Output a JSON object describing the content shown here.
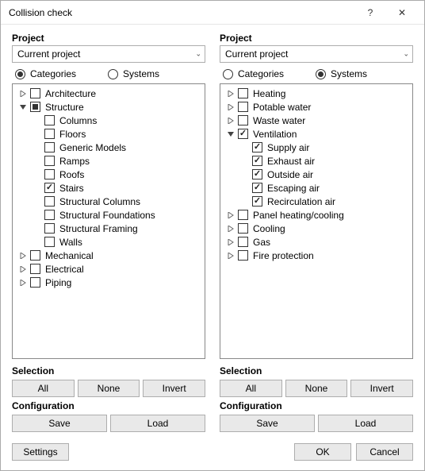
{
  "window": {
    "title": "Collision check",
    "help": "?",
    "close": "✕"
  },
  "left": {
    "project_label": "Project",
    "project_value": "Current project",
    "radio_categories": "Categories",
    "radio_systems": "Systems",
    "radio_selected": "categories",
    "tree": [
      {
        "depth": 0,
        "expander": "closed",
        "check": "unchecked",
        "label": "Architecture"
      },
      {
        "depth": 0,
        "expander": "open",
        "check": "ind",
        "label": "Structure"
      },
      {
        "depth": 1,
        "expander": "none",
        "check": "unchecked",
        "label": "Columns"
      },
      {
        "depth": 1,
        "expander": "none",
        "check": "unchecked",
        "label": "Floors"
      },
      {
        "depth": 1,
        "expander": "none",
        "check": "unchecked",
        "label": "Generic Models"
      },
      {
        "depth": 1,
        "expander": "none",
        "check": "unchecked",
        "label": "Ramps"
      },
      {
        "depth": 1,
        "expander": "none",
        "check": "unchecked",
        "label": "Roofs"
      },
      {
        "depth": 1,
        "expander": "none",
        "check": "checked",
        "label": "Stairs"
      },
      {
        "depth": 1,
        "expander": "none",
        "check": "unchecked",
        "label": "Structural Columns"
      },
      {
        "depth": 1,
        "expander": "none",
        "check": "unchecked",
        "label": "Structural Foundations"
      },
      {
        "depth": 1,
        "expander": "none",
        "check": "unchecked",
        "label": "Structural Framing"
      },
      {
        "depth": 1,
        "expander": "none",
        "check": "unchecked",
        "label": "Walls"
      },
      {
        "depth": 0,
        "expander": "closed",
        "check": "unchecked",
        "label": "Mechanical"
      },
      {
        "depth": 0,
        "expander": "closed",
        "check": "unchecked",
        "label": "Electrical"
      },
      {
        "depth": 0,
        "expander": "closed",
        "check": "unchecked",
        "label": "Piping"
      }
    ],
    "selection_label": "Selection",
    "btn_all": "All",
    "btn_none": "None",
    "btn_invert": "Invert",
    "config_label": "Configuration",
    "btn_save": "Save",
    "btn_load": "Load"
  },
  "right": {
    "project_label": "Project",
    "project_value": "Current project",
    "radio_categories": "Categories",
    "radio_systems": "Systems",
    "radio_selected": "systems",
    "tree": [
      {
        "depth": 0,
        "expander": "closed",
        "check": "unchecked",
        "label": "Heating"
      },
      {
        "depth": 0,
        "expander": "closed",
        "check": "unchecked",
        "label": "Potable water"
      },
      {
        "depth": 0,
        "expander": "closed",
        "check": "unchecked",
        "label": "Waste water"
      },
      {
        "depth": 0,
        "expander": "open",
        "check": "checked",
        "label": "Ventilation"
      },
      {
        "depth": 1,
        "expander": "none",
        "check": "checked",
        "label": "Supply air"
      },
      {
        "depth": 1,
        "expander": "none",
        "check": "checked",
        "label": "Exhaust air"
      },
      {
        "depth": 1,
        "expander": "none",
        "check": "checked",
        "label": "Outside air"
      },
      {
        "depth": 1,
        "expander": "none",
        "check": "checked",
        "label": "Escaping air"
      },
      {
        "depth": 1,
        "expander": "none",
        "check": "checked",
        "label": "Recirculation air"
      },
      {
        "depth": 0,
        "expander": "closed",
        "check": "unchecked",
        "label": "Panel heating/cooling"
      },
      {
        "depth": 0,
        "expander": "closed",
        "check": "unchecked",
        "label": "Cooling"
      },
      {
        "depth": 0,
        "expander": "closed",
        "check": "unchecked",
        "label": "Gas"
      },
      {
        "depth": 0,
        "expander": "closed",
        "check": "unchecked",
        "label": "Fire protection"
      }
    ],
    "selection_label": "Selection",
    "btn_all": "All",
    "btn_none": "None",
    "btn_invert": "Invert",
    "config_label": "Configuration",
    "btn_save": "Save",
    "btn_load": "Load"
  },
  "footer": {
    "settings": "Settings",
    "ok": "OK",
    "cancel": "Cancel"
  }
}
